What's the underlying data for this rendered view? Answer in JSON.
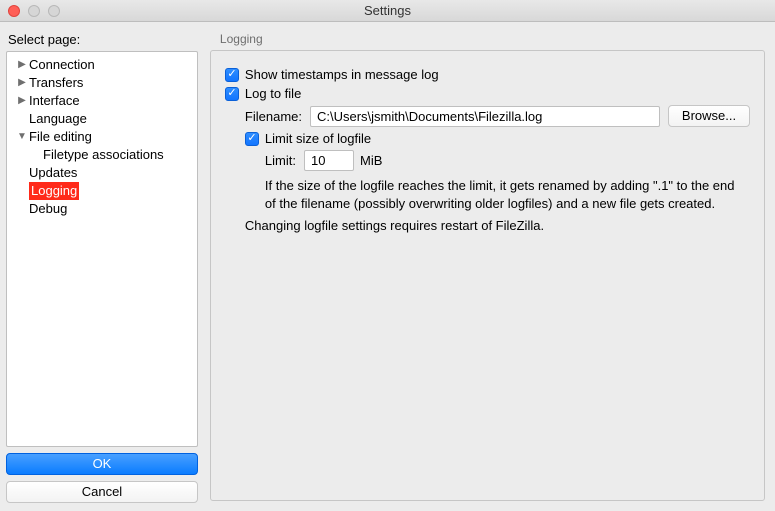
{
  "window": {
    "title": "Settings"
  },
  "sidebar": {
    "label": "Select page:",
    "items": [
      {
        "label": "Connection",
        "expandable": true,
        "expanded": false,
        "level": 0
      },
      {
        "label": "Transfers",
        "expandable": true,
        "expanded": false,
        "level": 0
      },
      {
        "label": "Interface",
        "expandable": true,
        "expanded": false,
        "level": 0
      },
      {
        "label": "Language",
        "expandable": false,
        "level": 0
      },
      {
        "label": "File editing",
        "expandable": true,
        "expanded": true,
        "level": 0
      },
      {
        "label": "Filetype associations",
        "expandable": false,
        "level": 1
      },
      {
        "label": "Updates",
        "expandable": false,
        "level": 0
      },
      {
        "label": "Logging",
        "expandable": false,
        "level": 0,
        "selected": true
      },
      {
        "label": "Debug",
        "expandable": false,
        "level": 0
      }
    ],
    "ok": "OK",
    "cancel": "Cancel"
  },
  "main": {
    "section_title": "Logging",
    "show_timestamps": "Show timestamps in message log",
    "log_to_file": "Log to file",
    "filename_label": "Filename:",
    "filename_value": "C:\\Users\\jsmith\\Documents\\Filezilla.log",
    "browse": "Browse...",
    "limit_size": "Limit size of logfile",
    "limit_label": "Limit:",
    "limit_value": "10",
    "limit_unit": "MiB",
    "help1": "If the size of the logfile reaches the limit, it gets renamed by adding \".1\" to the end of the filename (possibly overwriting older logfiles) and a new file gets created.",
    "help2": "Changing logfile settings requires restart of FileZilla."
  }
}
